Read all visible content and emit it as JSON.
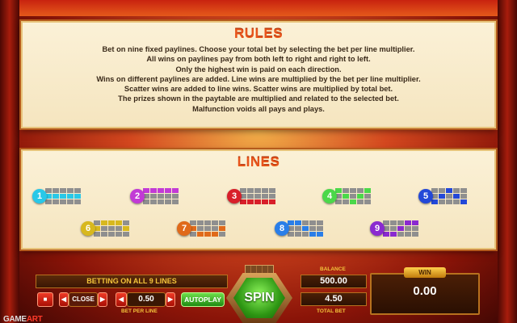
{
  "rules": {
    "title": "RULES",
    "lines": [
      "Bet on nine fixed paylines. Choose your total bet by selecting the bet per line multiplier.",
      "All wins on paylines pay from both left to right and right to left.",
      "Only the highest win is paid on each direction.",
      "Wins on different paylines are added. Line wins are multiplied by the bet per line multiplier.",
      "Scatter wins are added to line wins.  Scatter wins are multiplied by total bet.",
      "The prizes shown in the paytable are multiplied and related to the selected bet.",
      "Malfunction voids all pays and plays."
    ]
  },
  "lines": {
    "title": "LINES",
    "paylines": [
      {
        "number": "1",
        "color": "#29c8e8",
        "pattern": [
          1,
          1,
          1,
          1,
          1
        ]
      },
      {
        "number": "2",
        "color": "#c23ad6",
        "pattern": [
          0,
          0,
          0,
          0,
          0
        ]
      },
      {
        "number": "3",
        "color": "#d81f2a",
        "pattern": [
          2,
          2,
          2,
          2,
          2
        ]
      },
      {
        "number": "4",
        "color": "#4bd84a",
        "pattern": [
          0,
          1,
          2,
          1,
          0
        ]
      },
      {
        "number": "5",
        "color": "#2348d8",
        "pattern": [
          2,
          1,
          0,
          1,
          2
        ]
      },
      {
        "number": "6",
        "color": "#d8b81e",
        "pattern": [
          1,
          0,
          0,
          0,
          1
        ]
      },
      {
        "number": "7",
        "color": "#e06a1a",
        "pattern": [
          1,
          2,
          2,
          2,
          1
        ]
      },
      {
        "number": "8",
        "color": "#2a7ee8",
        "pattern": [
          0,
          0,
          1,
          2,
          2
        ]
      },
      {
        "number": "9",
        "color": "#8a2ad0",
        "pattern": [
          2,
          2,
          1,
          0,
          0
        ]
      }
    ]
  },
  "controls": {
    "betting_label": "BETTING ON ALL 9 LINES",
    "close_label": "CLOSE",
    "bet_per_line_value": "0.50",
    "bet_per_line_caption": "BET PER LINE",
    "autoplay_label": "AUTOPLAY",
    "spin_label": "SPIN",
    "balance_caption": "BALANCE",
    "balance_value": "500.00",
    "total_bet_value": "4.50",
    "total_bet_caption": "TOTAL BET",
    "win_label": "WIN",
    "win_value": "0.00",
    "logo_a": "GAME",
    "logo_b": "ART",
    "stop_icon": "stop-icon",
    "arrow_left_icon": "triangle-left-icon",
    "arrow_right_icon": "triangle-right-icon"
  }
}
